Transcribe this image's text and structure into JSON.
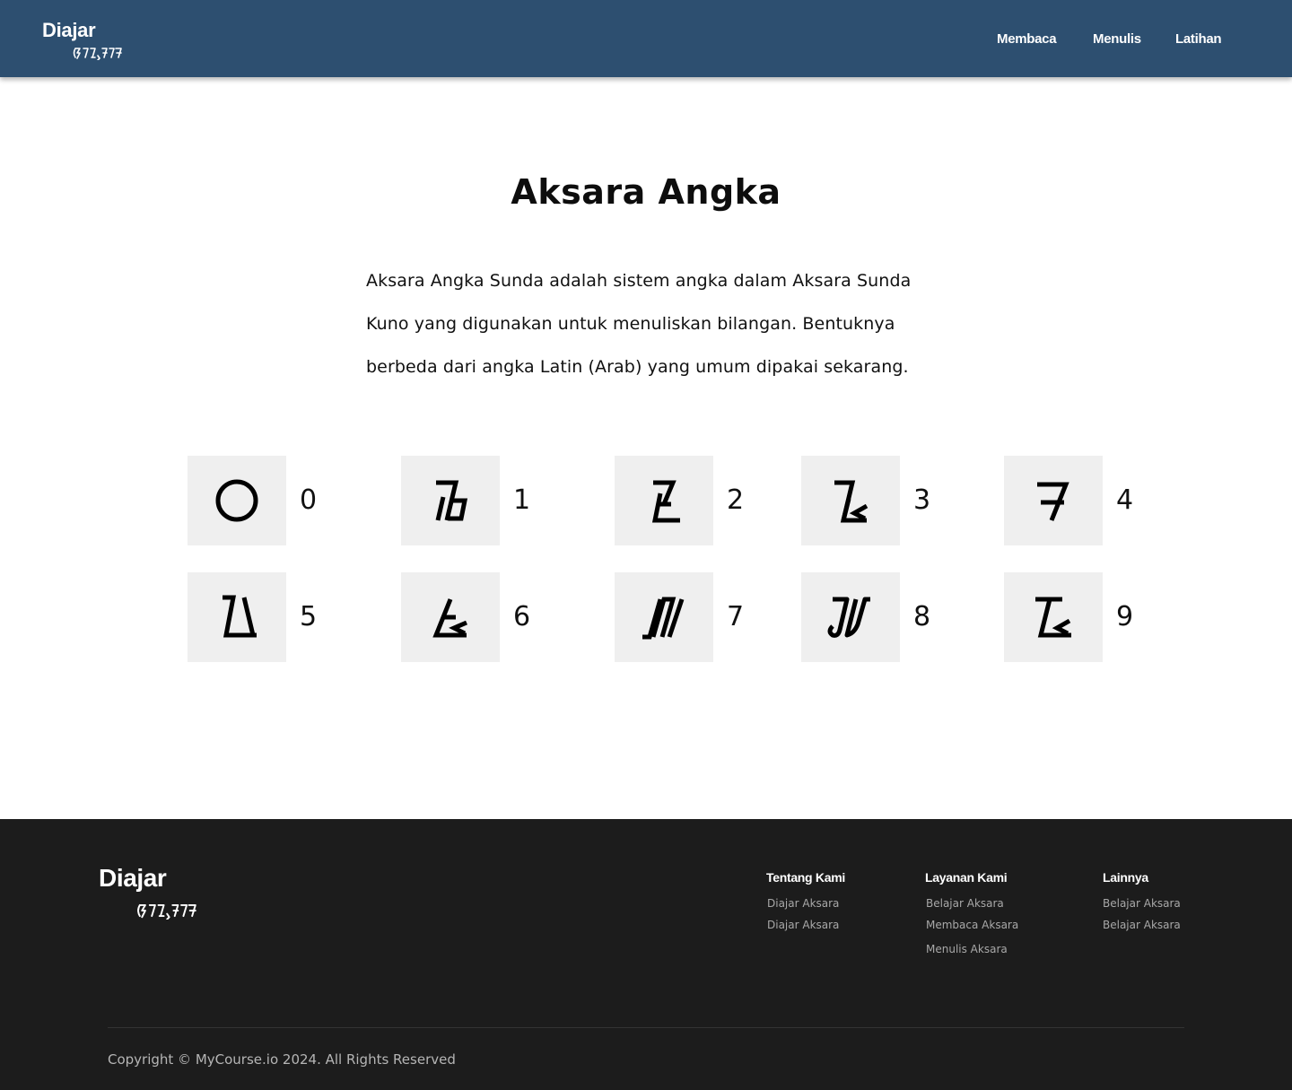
{
  "header": {
    "brand_title": "Diajar",
    "brand_script_icon": "sundanese-script-logo",
    "nav": [
      {
        "label": "Membaca"
      },
      {
        "label": "Menulis"
      },
      {
        "label": "Latihan"
      }
    ],
    "background_color": "#2d4f70"
  },
  "main": {
    "title": "Aksara Angka",
    "intro": "Aksara Angka Sunda adalah sistem angka dalam Aksara Sunda Kuno yang digunakan untuk menuliskan bilangan. Bentuknya berbeda dari angka Latin (Arab) yang umum dipakai sekarang.",
    "numerals": [
      {
        "digit": "0",
        "glyph_icon": "sundanese-digit-0-glyph"
      },
      {
        "digit": "1",
        "glyph_icon": "sundanese-digit-1-glyph"
      },
      {
        "digit": "2",
        "glyph_icon": "sundanese-digit-2-glyph"
      },
      {
        "digit": "3",
        "glyph_icon": "sundanese-digit-3-glyph"
      },
      {
        "digit": "4",
        "glyph_icon": "sundanese-digit-4-glyph"
      },
      {
        "digit": "5",
        "glyph_icon": "sundanese-digit-5-glyph"
      },
      {
        "digit": "6",
        "glyph_icon": "sundanese-digit-6-glyph"
      },
      {
        "digit": "7",
        "glyph_icon": "sundanese-digit-7-glyph"
      },
      {
        "digit": "8",
        "glyph_icon": "sundanese-digit-8-glyph"
      },
      {
        "digit": "9",
        "glyph_icon": "sundanese-digit-9-glyph"
      }
    ],
    "glyph_tile_color": "#efefef"
  },
  "footer": {
    "brand_title": "Diajar",
    "brand_script_icon": "sundanese-script-logo",
    "columns": [
      {
        "heading": "Tentang Kami",
        "links": [
          "Diajar Aksara",
          "Diajar Aksara"
        ]
      },
      {
        "heading": "Layanan Kami",
        "links": [
          "Belajar Aksara",
          "Membaca Aksara",
          "Menulis Aksara"
        ]
      },
      {
        "heading": "Lainnya",
        "links": [
          "Belajar Aksara",
          "Belajar Aksara"
        ]
      }
    ],
    "copyright": "Copyright © MyCourse.io 2024. All Rights Reserved",
    "background_color": "#1c1c1c"
  }
}
